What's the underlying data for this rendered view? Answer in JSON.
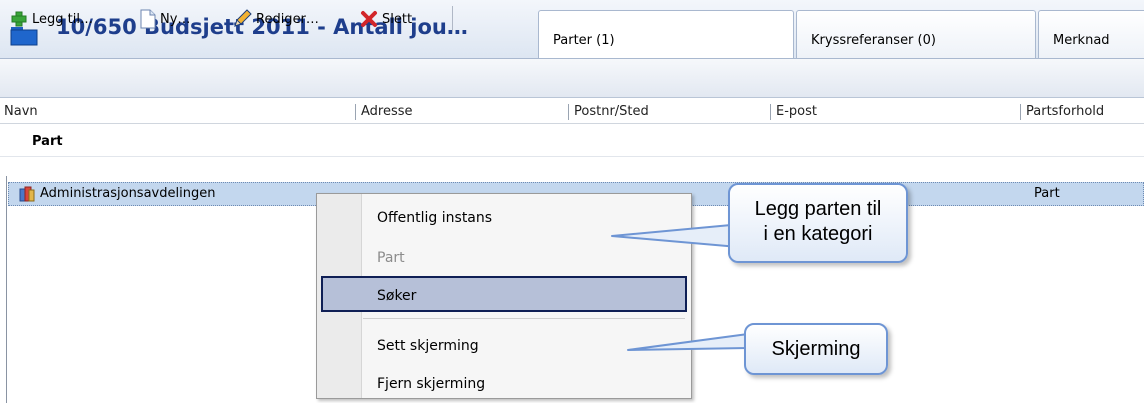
{
  "header": {
    "title": "10/650 Budsjett 2011 - Antall jou…",
    "tabs": [
      "Parter (1)",
      "Kryssreferanser (0)",
      "Merknad"
    ]
  },
  "toolbar": {
    "add_label": "Legg til…",
    "new_label": "Ny…",
    "edit_label": "Rediger…",
    "delete_label": "Slett"
  },
  "table": {
    "columns": [
      "Navn",
      "Adresse",
      "Postnr/Sted",
      "E-post",
      "Partsforhold"
    ],
    "group_label": "Part",
    "rows": [
      {
        "name": "Administrasjonsavdelingen",
        "relation": "Part"
      }
    ]
  },
  "context_menu": {
    "items": [
      "Offentlig instans",
      "Part",
      "Søker",
      "Sett skjerming",
      "Fjern skjerming"
    ],
    "disabled": "Part",
    "highlighted": "Søker"
  },
  "callouts": {
    "category_line1": "Legg parten til",
    "category_line2": "i en kategori",
    "shielding": "Skjerming"
  },
  "colors": {
    "title": "#1e3e8c",
    "selection": "#c3d7ee",
    "menu_highlight": "#b6c0d8"
  },
  "icons": [
    "folder-icon",
    "add-icon",
    "new-document-icon",
    "pencil-icon",
    "delete-icon",
    "party-icon"
  ]
}
